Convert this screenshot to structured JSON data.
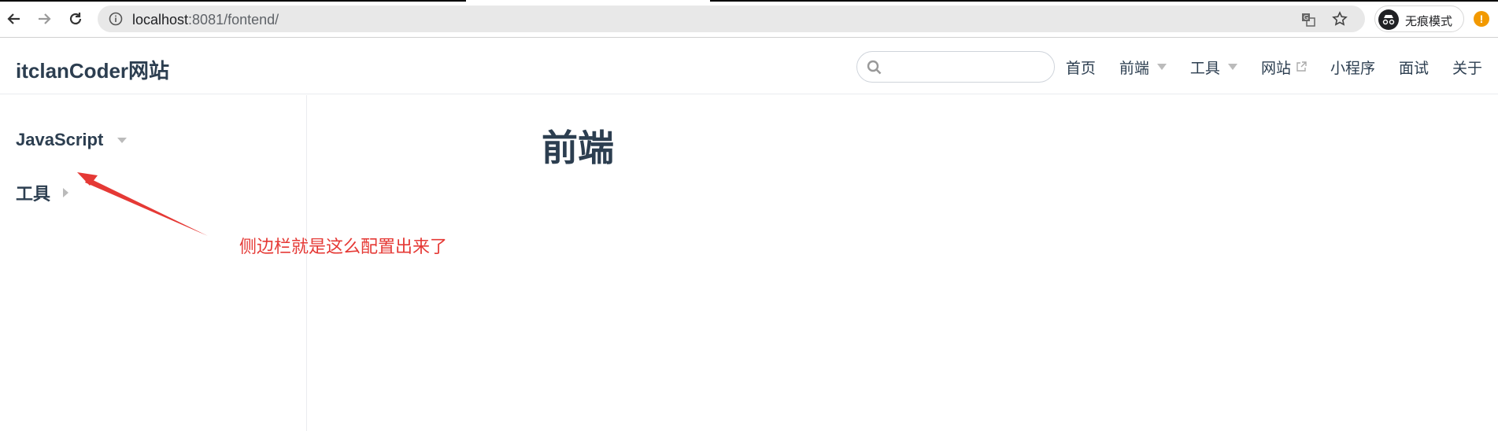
{
  "browser": {
    "url_host": "localhost",
    "url_rest": ":8081/fontend/",
    "incognito_label": "无痕模式",
    "icons": [
      "back-arrow-icon",
      "forward-arrow-icon",
      "reload-icon",
      "info-icon",
      "translate-icon",
      "star-icon",
      "incognito-icon",
      "alert-icon"
    ],
    "alert_glyph": "!"
  },
  "navbar": {
    "site_title": "itclanCoder网站",
    "search": {
      "value": "",
      "placeholder": ""
    },
    "links": [
      {
        "label": "首页"
      },
      {
        "label": "前端",
        "dropdown": true
      },
      {
        "label": "工具",
        "dropdown": true
      },
      {
        "label": "网站",
        "external": true
      },
      {
        "label": "小程序"
      },
      {
        "label": "面试"
      },
      {
        "label": "关于"
      }
    ]
  },
  "sidebar": {
    "groups": [
      {
        "label": "JavaScript",
        "state": "expanded"
      },
      {
        "label": "工具",
        "state": "collapsed"
      }
    ]
  },
  "main": {
    "heading": "前端"
  },
  "annotation": {
    "text": "侧边栏就是这么配置出来了",
    "color": "#e53935"
  },
  "colors": {
    "text": "#2c3e50",
    "border": "#eaecef",
    "caret": "#bbbbbb",
    "annotation": "#e53935"
  }
}
